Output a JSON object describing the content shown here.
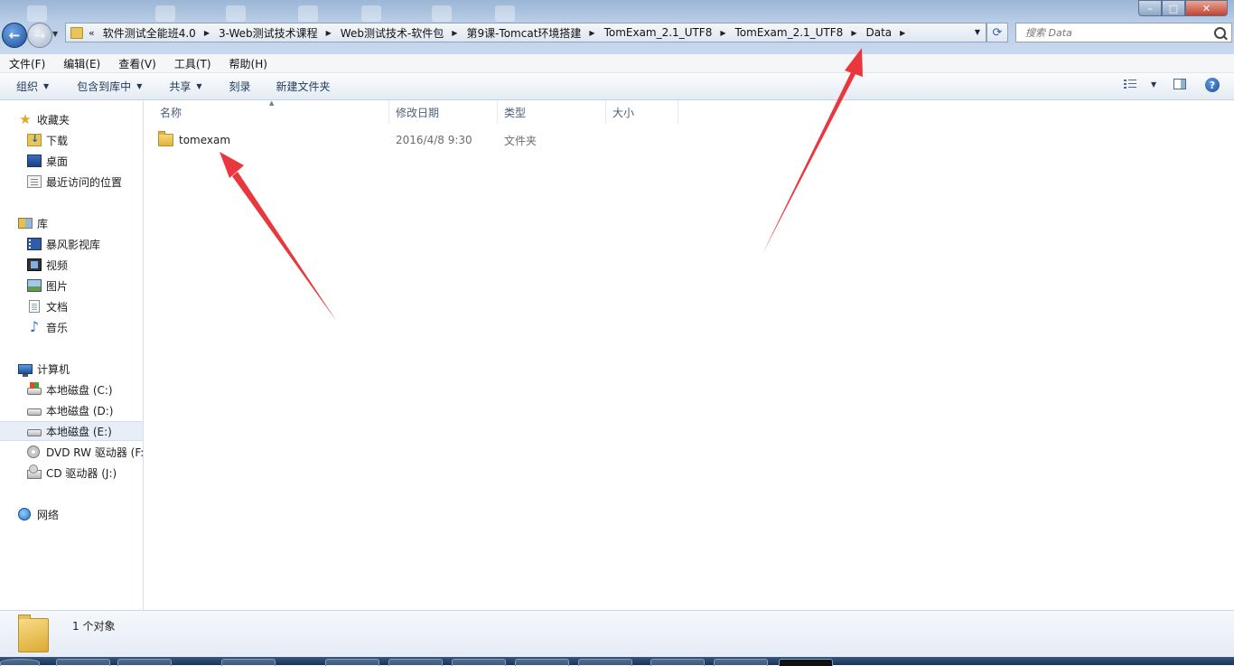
{
  "window": {
    "controls": {
      "minimize": "–",
      "maximize": "□",
      "close": "✕"
    }
  },
  "address_bar": {
    "lead": "«",
    "breadcrumbs": [
      "软件测试全能班4.0",
      "3-Web测试技术课程",
      "Web测试技术-软件包",
      "第9课-Tomcat环境搭建",
      "TomExam_2.1_UTF8",
      "TomExam_2.1_UTF8",
      "Data"
    ],
    "separator": "▶",
    "dropdown": "▼",
    "refresh_icon": "⟳"
  },
  "search": {
    "placeholder": "搜索 Data",
    "icon": "search-icon"
  },
  "menu": [
    "文件(F)",
    "编辑(E)",
    "查看(V)",
    "工具(T)",
    "帮助(H)"
  ],
  "toolbar": {
    "organize": "组织",
    "include_library": "包含到库中",
    "share": "共享",
    "burn": "刻录",
    "new_folder": "新建文件夹",
    "arrow": "▼",
    "help": "?"
  },
  "nav": {
    "favorites": {
      "label": "收藏夹",
      "items": [
        "下载",
        "桌面",
        "最近访问的位置"
      ]
    },
    "libraries": {
      "label": "库",
      "items": [
        "暴风影视库",
        "视频",
        "图片",
        "文档",
        "音乐"
      ]
    },
    "computer": {
      "label": "计算机",
      "items": [
        "本地磁盘 (C:)",
        "本地磁盘 (D:)",
        "本地磁盘 (E:)",
        "DVD RW 驱动器 (F:",
        "CD 驱动器 (J:)"
      ],
      "selected": "本地磁盘 (E:)"
    },
    "network": {
      "label": "网络"
    }
  },
  "columns": {
    "name": "名称",
    "modified": "修改日期",
    "type": "类型",
    "size": "大小",
    "sort_arrow": "▲"
  },
  "files": [
    {
      "name": "tomexam",
      "modified": "2016/4/8 9:30",
      "type": "文件夹",
      "size": ""
    }
  ],
  "status": {
    "count": "1 个对象"
  },
  "colors": {
    "annotation_arrow": "#e8383d",
    "title_gradient": "#b9cde6",
    "selection": "#e7eef7"
  }
}
